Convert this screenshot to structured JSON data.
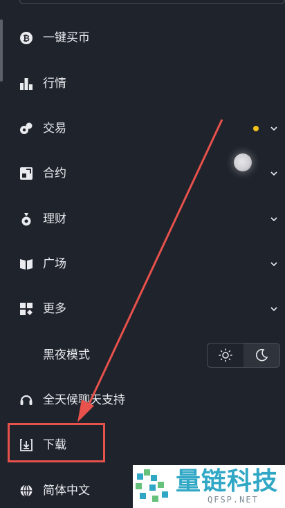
{
  "menu": {
    "items": [
      {
        "label": "一键买币",
        "icon": "bitcoin-icon"
      },
      {
        "label": "行情",
        "icon": "bar-chart-icon"
      },
      {
        "label": "交易",
        "icon": "trade-icon",
        "has_dot": true,
        "has_chevron": true
      },
      {
        "label": "合约",
        "icon": "contract-icon",
        "has_chevron": true
      },
      {
        "label": "理财",
        "icon": "money-bag-icon",
        "has_chevron": true
      },
      {
        "label": "广场",
        "icon": "book-icon",
        "has_chevron": true
      },
      {
        "label": "更多",
        "icon": "grid-icon",
        "has_chevron": true
      },
      {
        "label": "黑夜模式"
      },
      {
        "label": "全天候聊天支持",
        "icon": "headset-icon"
      },
      {
        "label": "下载",
        "icon": "download-icon"
      },
      {
        "label": "简体中文",
        "icon": "globe-icon"
      }
    ]
  },
  "theme_toggle": {
    "options": [
      "sun-icon",
      "moon-icon"
    ],
    "selected": "moon-icon"
  },
  "colors": {
    "background": "#1f232b",
    "text": "#e9ebef",
    "notification_dot": "#f2c21b",
    "annotation_red": "#e8514c",
    "watermark_blue": "#2fa7c5"
  },
  "watermark": {
    "title": "量链科技",
    "subtitle": "QFSP.NET"
  }
}
